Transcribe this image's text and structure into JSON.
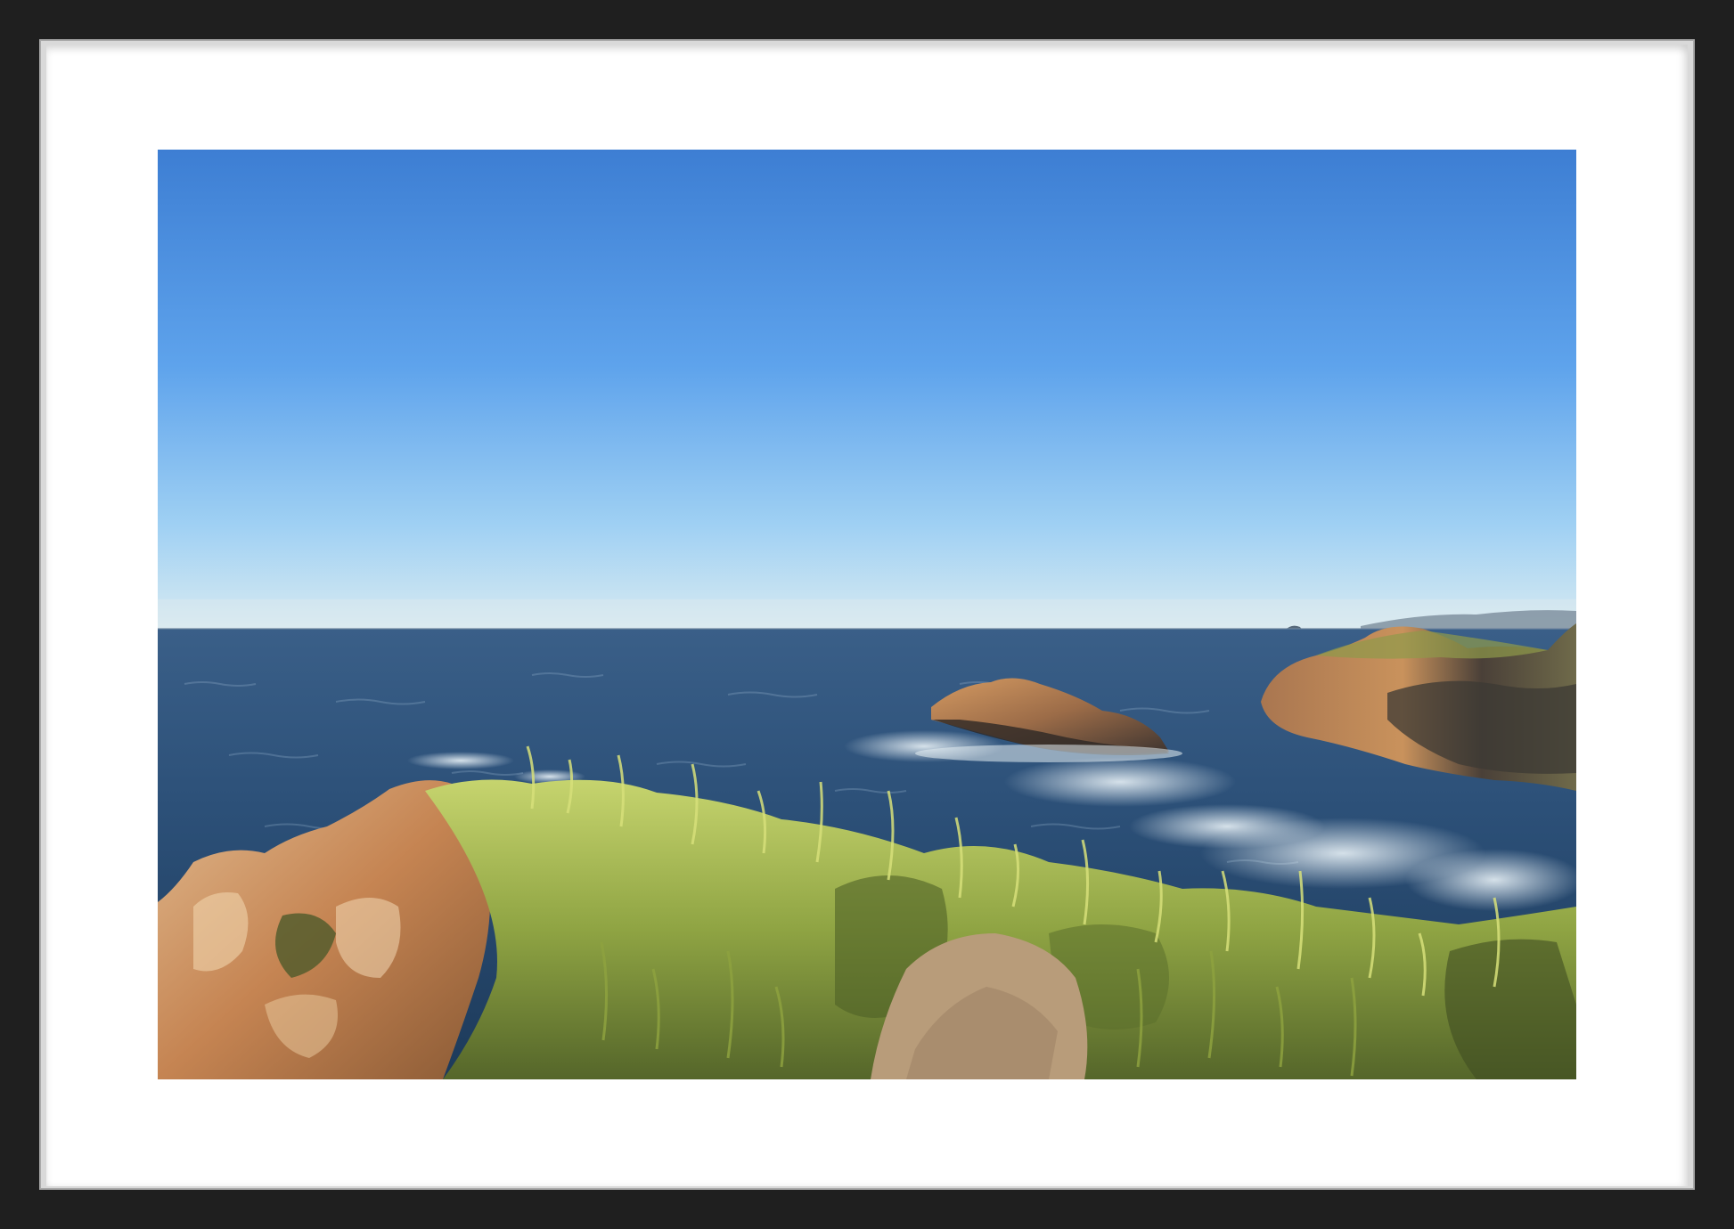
{
  "colors": {
    "frame": "#1f1f1f",
    "mat": "#ffffff",
    "sky_top": "#3f7fd4",
    "sky_mid": "#6aaaf0",
    "sky_horizon": "#cde7f5",
    "sea_far": "#2f5178",
    "sea_near": "#1f3c5c",
    "surf": "#dbe8f0",
    "rock_lit": "#c98a55",
    "rock_shadow": "#3b3430",
    "grass_light": "#c9d56a",
    "grass_dark": "#5b6f2b"
  },
  "scene": {
    "subject": "coastal-seascape",
    "elements": [
      "sky",
      "horizon",
      "ocean",
      "offshore-rock",
      "headland",
      "surf",
      "grassy-cliff",
      "dirt-path"
    ]
  }
}
